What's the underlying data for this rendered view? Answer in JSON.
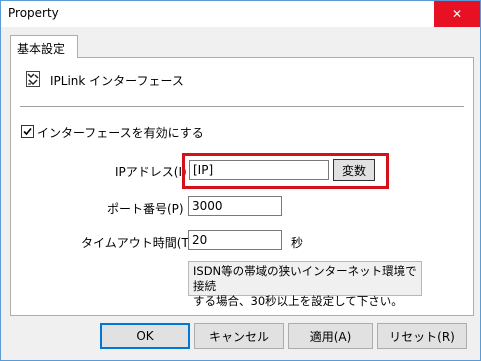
{
  "window": {
    "title": "Property",
    "close_glyph": "✕"
  },
  "tab": {
    "label": "基本設定"
  },
  "header": {
    "title": "IPLink インターフェース"
  },
  "enable": {
    "label": "インターフェースを有効にする",
    "checked": true
  },
  "ip": {
    "label": "IPアドレス(I) :",
    "value": "[IP]",
    "button": "変数"
  },
  "port": {
    "label": "ポート番号(P) :",
    "value": "3000"
  },
  "timeout": {
    "label": "タイムアウト時間(T) :",
    "value": "20",
    "unit": "秒"
  },
  "note": {
    "line1": "ISDN等の帯域の狭いインターネット環境で接続",
    "line2": "する場合、30秒以上を設定して下さい。"
  },
  "buttons": {
    "ok": "OK",
    "cancel": "キャンセル",
    "apply": "適用(A)",
    "reset": "リセット(R)"
  },
  "colors": {
    "highlight": "#d4101a",
    "close": "#e81123",
    "accent": "#0078d7"
  }
}
